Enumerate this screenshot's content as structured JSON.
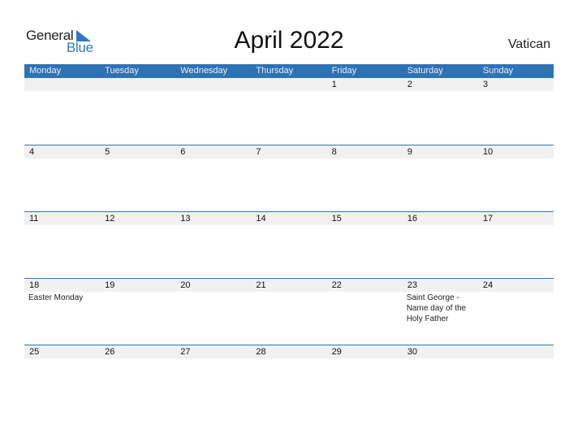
{
  "logo": {
    "word1": "General",
    "word2": "Blue"
  },
  "title": "April 2022",
  "country": "Vatican",
  "colors": {
    "header_bg": "#2f72b3",
    "date_row_bg": "#f1f1f1",
    "brand_blue": "#2f7ac0"
  },
  "weekdays": [
    "Monday",
    "Tuesday",
    "Wednesday",
    "Thursday",
    "Friday",
    "Saturday",
    "Sunday"
  ],
  "weeks": [
    {
      "dates": [
        "",
        "",
        "",
        "",
        "1",
        "2",
        "3"
      ],
      "events": [
        "",
        "",
        "",
        "",
        "",
        "",
        ""
      ]
    },
    {
      "dates": [
        "4",
        "5",
        "6",
        "7",
        "8",
        "9",
        "10"
      ],
      "events": [
        "",
        "",
        "",
        "",
        "",
        "",
        ""
      ]
    },
    {
      "dates": [
        "11",
        "12",
        "13",
        "14",
        "15",
        "16",
        "17"
      ],
      "events": [
        "",
        "",
        "",
        "",
        "",
        "",
        ""
      ]
    },
    {
      "dates": [
        "18",
        "19",
        "20",
        "21",
        "22",
        "23",
        "24"
      ],
      "events": [
        "Easter Monday",
        "",
        "",
        "",
        "",
        "Saint George - Name day of the Holy Father",
        ""
      ]
    },
    {
      "dates": [
        "25",
        "26",
        "27",
        "28",
        "29",
        "30",
        ""
      ],
      "events": [
        "",
        "",
        "",
        "",
        "",
        "",
        ""
      ]
    }
  ]
}
